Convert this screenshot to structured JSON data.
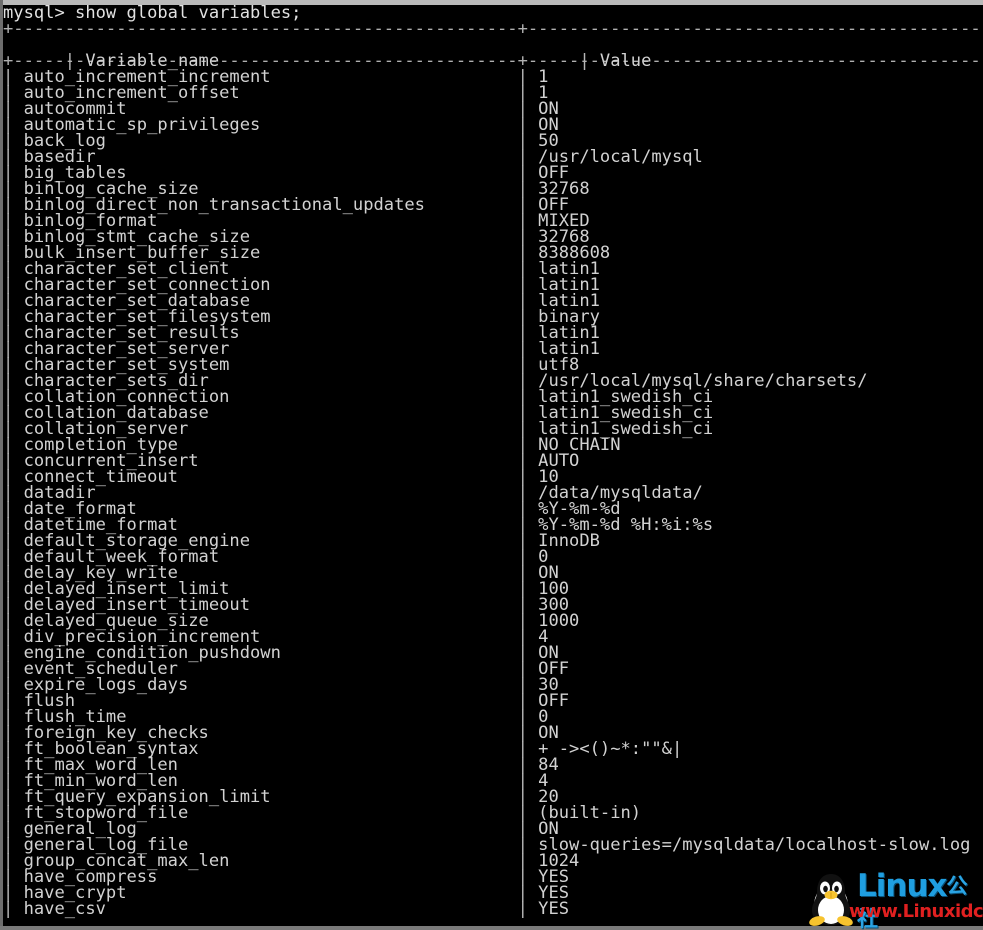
{
  "terminal": {
    "prompt": "mysql> show global variables;",
    "separator_top": "+------------------------------------------------+------------------------------------------------------------",
    "separator_mid": "+------------------------------------------------+------------------------------------------------------------",
    "columns": [
      "Variable_name",
      "Value"
    ],
    "name_col_width": 48,
    "rows": [
      {
        "name": "auto_increment_increment",
        "value": "1"
      },
      {
        "name": "auto_increment_offset",
        "value": "1"
      },
      {
        "name": "autocommit",
        "value": "ON"
      },
      {
        "name": "automatic_sp_privileges",
        "value": "ON"
      },
      {
        "name": "back_log",
        "value": "50"
      },
      {
        "name": "basedir",
        "value": "/usr/local/mysql"
      },
      {
        "name": "big_tables",
        "value": "OFF"
      },
      {
        "name": "binlog_cache_size",
        "value": "32768"
      },
      {
        "name": "binlog_direct_non_transactional_updates",
        "value": "OFF"
      },
      {
        "name": "binlog_format",
        "value": "MIXED"
      },
      {
        "name": "binlog_stmt_cache_size",
        "value": "32768"
      },
      {
        "name": "bulk_insert_buffer_size",
        "value": "8388608"
      },
      {
        "name": "character_set_client",
        "value": "latin1"
      },
      {
        "name": "character_set_connection",
        "value": "latin1"
      },
      {
        "name": "character_set_database",
        "value": "latin1"
      },
      {
        "name": "character_set_filesystem",
        "value": "binary"
      },
      {
        "name": "character_set_results",
        "value": "latin1"
      },
      {
        "name": "character_set_server",
        "value": "latin1"
      },
      {
        "name": "character_set_system",
        "value": "utf8"
      },
      {
        "name": "character_sets_dir",
        "value": "/usr/local/mysql/share/charsets/"
      },
      {
        "name": "collation_connection",
        "value": "latin1_swedish_ci"
      },
      {
        "name": "collation_database",
        "value": "latin1_swedish_ci"
      },
      {
        "name": "collation_server",
        "value": "latin1_swedish_ci"
      },
      {
        "name": "completion_type",
        "value": "NO_CHAIN"
      },
      {
        "name": "concurrent_insert",
        "value": "AUTO"
      },
      {
        "name": "connect_timeout",
        "value": "10"
      },
      {
        "name": "datadir",
        "value": "/data/mysqldata/"
      },
      {
        "name": "date_format",
        "value": "%Y-%m-%d"
      },
      {
        "name": "datetime_format",
        "value": "%Y-%m-%d %H:%i:%s"
      },
      {
        "name": "default_storage_engine",
        "value": "InnoDB"
      },
      {
        "name": "default_week_format",
        "value": "0"
      },
      {
        "name": "delay_key_write",
        "value": "ON"
      },
      {
        "name": "delayed_insert_limit",
        "value": "100"
      },
      {
        "name": "delayed_insert_timeout",
        "value": "300"
      },
      {
        "name": "delayed_queue_size",
        "value": "1000"
      },
      {
        "name": "div_precision_increment",
        "value": "4"
      },
      {
        "name": "engine_condition_pushdown",
        "value": "ON"
      },
      {
        "name": "event_scheduler",
        "value": "OFF"
      },
      {
        "name": "expire_logs_days",
        "value": "30"
      },
      {
        "name": "flush",
        "value": "OFF"
      },
      {
        "name": "flush_time",
        "value": "0"
      },
      {
        "name": "foreign_key_checks",
        "value": "ON"
      },
      {
        "name": "ft_boolean_syntax",
        "value": "+ -><()~*:\"\"&|"
      },
      {
        "name": "ft_max_word_len",
        "value": "84"
      },
      {
        "name": "ft_min_word_len",
        "value": "4"
      },
      {
        "name": "ft_query_expansion_limit",
        "value": "20"
      },
      {
        "name": "ft_stopword_file",
        "value": "(built-in)"
      },
      {
        "name": "general_log",
        "value": "ON"
      },
      {
        "name": "general_log_file",
        "value": "slow-queries=/mysqldata/localhost-slow.log"
      },
      {
        "name": "group_concat_max_len",
        "value": "1024"
      },
      {
        "name": "have_compress",
        "value": "YES"
      },
      {
        "name": "have_crypt",
        "value": "YES"
      },
      {
        "name": "have_csv",
        "value": "YES"
      }
    ]
  },
  "watermark": {
    "brand": "Linux",
    "brand_suffix": "公社",
    "url": "www.Linuxidc.com",
    "brand_color": "#1f9ee0",
    "url_color": "#e02020"
  }
}
